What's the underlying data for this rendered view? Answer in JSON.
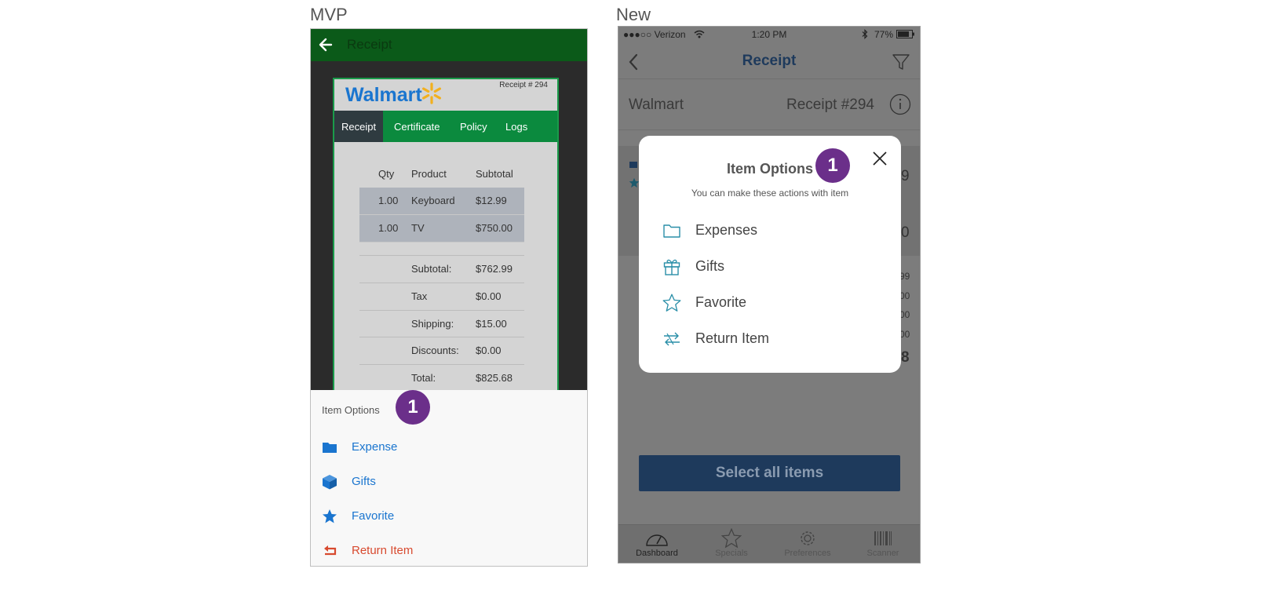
{
  "labels": {
    "mvp": "MVP",
    "new": "New"
  },
  "badge": "1",
  "mvp": {
    "appbar_title": "Receipt",
    "store": "Walmart",
    "receipt_no": "Receipt # 294",
    "tabs": [
      "Receipt",
      "Certificate",
      "Policy",
      "Logs"
    ],
    "columns": {
      "qty": "Qty",
      "product": "Product",
      "subtotal": "Subtotal"
    },
    "items": [
      {
        "qty": "1.00",
        "product": "Keyboard",
        "subtotal": "$12.99"
      },
      {
        "qty": "1.00",
        "product": "TV",
        "subtotal": "$750.00"
      }
    ],
    "summary": [
      {
        "label": "Subtotal:",
        "value": "$762.99"
      },
      {
        "label": "Tax",
        "value": "$0.00"
      },
      {
        "label": "Shipping:",
        "value": "$15.00"
      },
      {
        "label": "Discounts:",
        "value": "$0.00"
      },
      {
        "label": "Total:",
        "value": "$825.68"
      }
    ],
    "sheet_title": "Item Options",
    "options": [
      {
        "label": "Expense",
        "icon": "folder-icon"
      },
      {
        "label": "Gifts",
        "icon": "box-icon"
      },
      {
        "label": "Favorite",
        "icon": "star-icon"
      },
      {
        "label": "Return Item",
        "icon": "return-icon"
      }
    ],
    "colors": {
      "appbar": "#0b5a19",
      "tabs": "#0b8a3e",
      "link": "#1a75cf",
      "return": "#d84a2f",
      "brand_spark": "#f2b01e"
    }
  },
  "new": {
    "status": {
      "carrier": "●●●○○ Verizon",
      "time": "1:20 PM",
      "battery": "77%"
    },
    "nav_title": "Receipt",
    "store": "Walmart",
    "receipt_no": "Receipt #294",
    "fragments": [
      "9",
      "0",
      "99",
      "00",
      "00",
      "00",
      "8"
    ],
    "modal": {
      "title": "Item Options",
      "subtitle": "You can make these actions with item",
      "options": [
        {
          "label": "Expenses",
          "icon": "folder-outline-icon"
        },
        {
          "label": "Gifts",
          "icon": "gift-icon"
        },
        {
          "label": "Favorite",
          "icon": "star-outline-icon"
        },
        {
          "label": "Return Item",
          "icon": "return-arrows-icon"
        }
      ]
    },
    "select_all": "Select all items",
    "tabbar": [
      {
        "label": "Dashboard",
        "icon": "dashboard-icon"
      },
      {
        "label": "Specials",
        "icon": "star-icon"
      },
      {
        "label": "Preferences",
        "icon": "gear-icon"
      },
      {
        "label": "Scanner",
        "icon": "barcode-icon"
      }
    ],
    "colors": {
      "navy": "#1e3a5c",
      "icon_teal": "#2a8fa8",
      "badge": "#6b2f8a"
    }
  }
}
